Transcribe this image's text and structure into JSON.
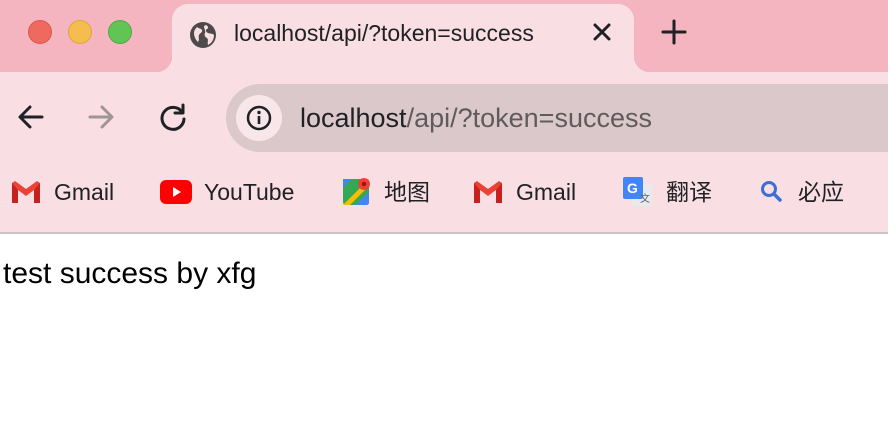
{
  "window": {
    "controls": [
      "close",
      "minimize",
      "maximize"
    ]
  },
  "tab": {
    "favicon": "globe-icon",
    "title": "localhost/api/?token=success",
    "close_icon": "close-icon"
  },
  "new_tab_icon": "plus-icon",
  "toolbar": {
    "back_icon": "arrow-left-icon",
    "forward_icon": "arrow-right-icon",
    "reload_icon": "reload-icon",
    "site_info_icon": "info-icon",
    "url_host": "localhost",
    "url_path": "/api/?token=success"
  },
  "bookmarks": [
    {
      "label": "Gmail",
      "icon": "gmail-icon"
    },
    {
      "label": "YouTube",
      "icon": "youtube-icon"
    },
    {
      "label": "地图",
      "icon": "maps-icon"
    },
    {
      "label": "Gmail",
      "icon": "gmail-icon"
    },
    {
      "label": "翻译",
      "icon": "translate-icon"
    },
    {
      "label": "必应",
      "icon": "search-icon"
    }
  ],
  "page": {
    "body_text": "test success by xfg"
  },
  "colors": {
    "tabstrip_bg": "#f4b4c0",
    "toolbar_bg": "#f9dfe4",
    "omnibox_bg": "#dbc8cb"
  }
}
